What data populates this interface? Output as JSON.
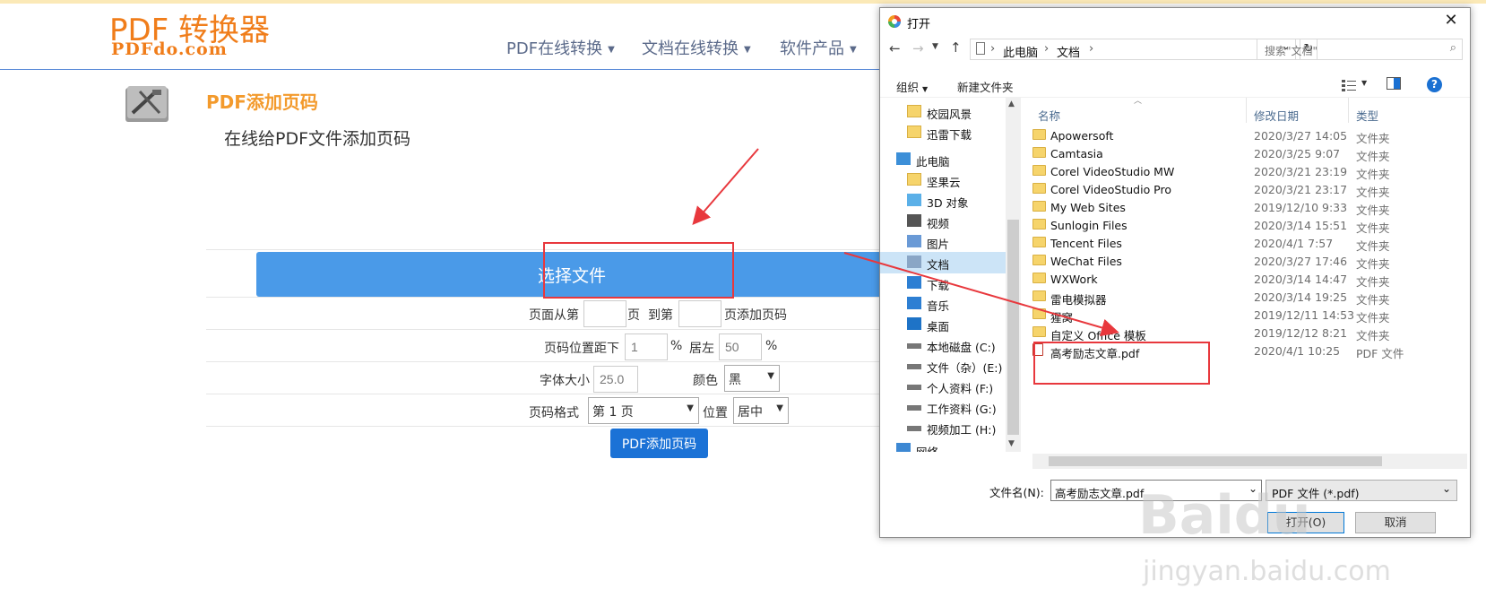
{
  "site": {
    "logo_top": "PDF 转换器",
    "logo_bottom": "PDFdo.com",
    "nav": [
      "PDF在线转换",
      "文档在线转换",
      "软件产品"
    ],
    "tool_title": "PDF添加页码",
    "tool_subtitle": "在线给PDF文件添加页码",
    "choose_file": "选择文件",
    "form": {
      "page_from": "页面从第",
      "page_unit": "页",
      "page_to": "到第",
      "page_add": "页添加页码",
      "pos_bottom": "页码位置距下",
      "pos_bottom_value": "1",
      "percent": "%",
      "left": "居左",
      "left_value": "50",
      "font_size": "字体大小",
      "font_size_value": "25.0",
      "color": "颜色",
      "color_value": "黑",
      "page_format": "页码格式",
      "page_format_value": "第 1 页",
      "position": "位置",
      "position_value": "居中"
    },
    "submit": "PDF添加页码"
  },
  "dialog": {
    "title": "打开",
    "close": "✕",
    "breadcrumb": [
      "此电脑",
      "文档"
    ],
    "search_placeholder": "搜索\"文档\"",
    "organize": "组织",
    "new_folder": "新建文件夹",
    "help": "?",
    "tree": [
      {
        "label": "校园风景",
        "icon": "folder-icon"
      },
      {
        "label": "迅雷下载",
        "icon": "folder-icon"
      },
      {
        "label": "此电脑",
        "icon": "computer-icon"
      },
      {
        "label": "坚果云",
        "icon": "folder-icon"
      },
      {
        "label": "3D 对象",
        "icon": "3d-objects-icon"
      },
      {
        "label": "视频",
        "icon": "video-icon"
      },
      {
        "label": "图片",
        "icon": "picture-icon"
      },
      {
        "label": "文档",
        "icon": "document-icon"
      },
      {
        "label": "下载",
        "icon": "download-icon"
      },
      {
        "label": "音乐",
        "icon": "music-icon"
      },
      {
        "label": "桌面",
        "icon": "desktop-icon"
      },
      {
        "label": "本地磁盘 (C:)",
        "icon": "drive-icon"
      },
      {
        "label": "文件（杂）(E:)",
        "icon": "drive-icon"
      },
      {
        "label": "个人资料 (F:)",
        "icon": "drive-icon"
      },
      {
        "label": "工作资料 (G:)",
        "icon": "drive-icon"
      },
      {
        "label": "视频加工 (H:)",
        "icon": "drive-icon"
      },
      {
        "label": "网络",
        "icon": "network-icon"
      }
    ],
    "columns": {
      "name": "名称",
      "date": "修改日期",
      "type": "类型"
    },
    "files": [
      {
        "name": "Apowersoft",
        "date": "2020/3/27 14:05",
        "type": "文件夹"
      },
      {
        "name": "Camtasia",
        "date": "2020/3/25 9:07",
        "type": "文件夹"
      },
      {
        "name": "Corel VideoStudio MW",
        "date": "2020/3/21 23:19",
        "type": "文件夹"
      },
      {
        "name": "Corel VideoStudio Pro",
        "date": "2020/3/21 23:17",
        "type": "文件夹"
      },
      {
        "name": "My Web Sites",
        "date": "2019/12/10 9:33",
        "type": "文件夹"
      },
      {
        "name": "Sunlogin Files",
        "date": "2020/3/14 15:51",
        "type": "文件夹"
      },
      {
        "name": "Tencent Files",
        "date": "2020/4/1 7:57",
        "type": "文件夹"
      },
      {
        "name": "WeChat Files",
        "date": "2020/3/27 17:46",
        "type": "文件夹"
      },
      {
        "name": "WXWork",
        "date": "2020/3/14 14:47",
        "type": "文件夹"
      },
      {
        "name": "雷电模拟器",
        "date": "2020/3/14 19:25",
        "type": "文件夹"
      },
      {
        "name": "猩窝",
        "date": "2019/12/11 14:53",
        "type": "文件夹"
      },
      {
        "name": "自定义 Office 模板",
        "date": "2019/12/12 8:21",
        "type": "文件夹"
      },
      {
        "name": "高考励志文章.pdf",
        "date": "2020/4/1 10:25",
        "type": "PDF 文件"
      }
    ],
    "filename_label": "文件名(N):",
    "filename_value": "高考励志文章.pdf",
    "filetype_value": "PDF 文件 (*.pdf)",
    "open_button": "打开(O)",
    "cancel_button": "取消"
  },
  "watermark": {
    "main": "Baidu",
    "sub": "jingyan.baidu.com"
  },
  "colors": {
    "accent_orange": "#f07d1a",
    "button_blue": "#4a9ae8",
    "annotation_red": "#e8383d"
  }
}
